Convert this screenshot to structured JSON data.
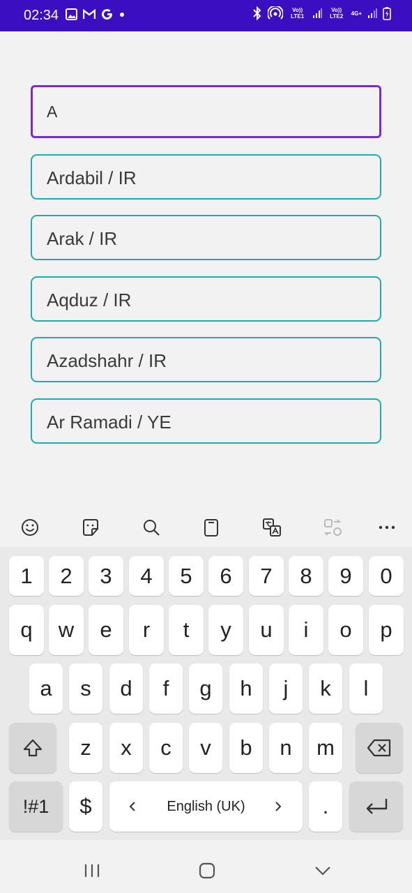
{
  "status_bar": {
    "time": "02:34",
    "left_icons": [
      "image-icon",
      "gmail-icon",
      "google-icon",
      "dot-icon"
    ],
    "sim1_label": "Vo)) LTE1",
    "sim2_label": "Vo)) LTE2",
    "network": "4G+"
  },
  "search": {
    "value": "A"
  },
  "suggestions": [
    {
      "label": "Ardabil / IR"
    },
    {
      "label": "Arak / IR"
    },
    {
      "label": "Aqduz / IR"
    },
    {
      "label": "Azadshahr / IR"
    },
    {
      "label": "Ar Ramadi / YE"
    }
  ],
  "keyboard_toolbar": [
    "emoji-icon",
    "sticker-icon",
    "search-icon",
    "clipboard-icon",
    "translate-icon",
    "convert-icon",
    "more-icon"
  ],
  "keyboard": {
    "row_numbers": [
      "1",
      "2",
      "3",
      "4",
      "5",
      "6",
      "7",
      "8",
      "9",
      "0"
    ],
    "row_q": [
      "q",
      "w",
      "e",
      "r",
      "t",
      "y",
      "u",
      "i",
      "o",
      "p"
    ],
    "row_a": [
      "a",
      "s",
      "d",
      "f",
      "g",
      "h",
      "j",
      "k",
      "l"
    ],
    "row_z": [
      "z",
      "x",
      "c",
      "v",
      "b",
      "n",
      "m"
    ],
    "symbols_label": "!#1",
    "currency_label": "$",
    "space_label": "English (UK)",
    "period_label": "."
  },
  "navbar": [
    "recent-apps-icon",
    "home-icon",
    "back-icon"
  ]
}
